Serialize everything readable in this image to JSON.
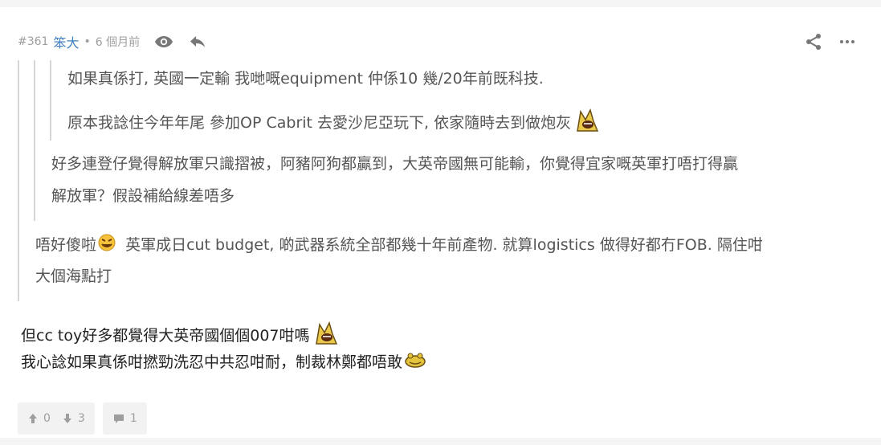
{
  "post": {
    "number": "#361",
    "author": "笨大",
    "separator": "•",
    "time": "6 個月前"
  },
  "quotes": {
    "level3": [
      "如果真係打, 英國一定輸 我哋嘅equipment 仲係10 幾/20年前既科技.",
      "原本我諗住今年年尾 參加OP Cabrit 去愛沙尼亞玩下, 依家隨時去到做炮灰"
    ],
    "level2": [
      "好多連登仔覺得解放軍只識摺被，阿豬阿狗都贏到，大英帝國無可能輸，你覺得宜家嘅英軍打唔打得贏",
      "解放軍？假設補給線差唔多"
    ],
    "level1": [
      "唔好傻啦",
      "英軍成日cut budget, 啲武器系統全部都幾十年前產物. 就算logistics 做得好都冇FOB. 隔住咁",
      "大個海點打"
    ]
  },
  "content": {
    "line1": "但cc toy好多都覺得大英帝國個個007咁嗎",
    "line2": "我心諗如果真係咁撚勁洗忍中共忍咁耐，制裁林鄭都唔敢"
  },
  "actions": {
    "upvotes": "0",
    "downvotes": "3",
    "replies": "1"
  },
  "icons": {
    "view": "eye-icon",
    "reply": "reply-icon",
    "share": "share-icon",
    "more": "more-icon",
    "up": "thumb-up-icon",
    "down": "thumb-down-icon",
    "comment": "comment-icon"
  },
  "colors": {
    "author": "#3f7fbf",
    "meta": "#9e9e9e",
    "quote_text": "#555555",
    "body_text": "#222222",
    "quote_border": "#d6d6d6"
  }
}
